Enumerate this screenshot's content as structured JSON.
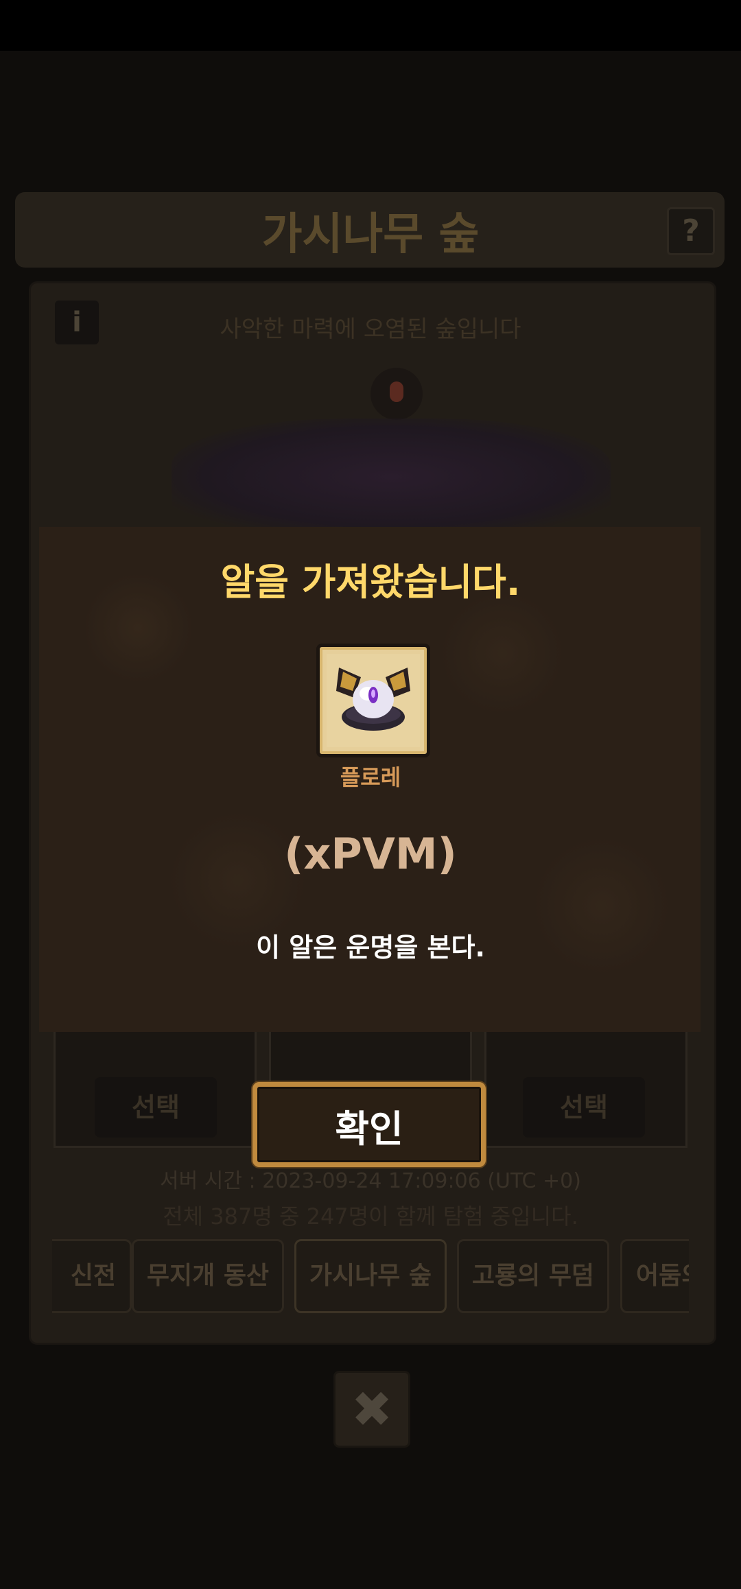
{
  "background": {
    "title": "가시나무 숲",
    "help_icon": "question-icon",
    "help_label": "?",
    "info_label": "i",
    "description": "사악한 마력에 오염된 숲입니다",
    "select_left": "선택",
    "select_right": "선택",
    "server_time": "서버 시간 : 2023-09-24 17:09:06 (UTC +0)",
    "players": "전체 387명 중 247명이 함께 탐험 중입니다.",
    "tabs": [
      "신전",
      "무지개 동산",
      "가시나무 숲",
      "고룡의 무덤",
      "어둠의"
    ],
    "active_tab": "가시나무 숲",
    "close_label": "✖"
  },
  "dialog": {
    "title": "알을 가져왔습니다.",
    "egg_icon": "egg-icon",
    "egg_name": "플로레",
    "egg_code": "(xPVM)",
    "egg_description": "이 알은 운명을 본다.",
    "confirm_label": "확인"
  },
  "colors": {
    "dialog_title": "#ffd86a",
    "egg_name": "#d79a59",
    "confirm_border": "#c08a3e"
  }
}
